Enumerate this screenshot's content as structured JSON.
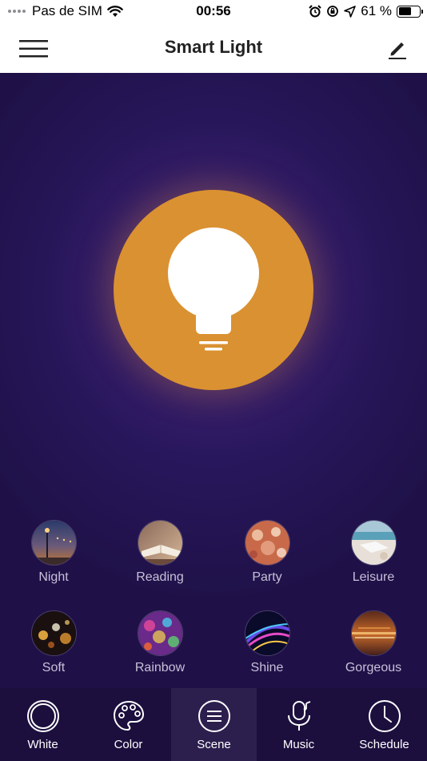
{
  "status_bar": {
    "carrier": "Pas de SIM",
    "time": "00:56",
    "battery": "61 %",
    "battery_level": 0.61
  },
  "nav": {
    "title": "Smart Light",
    "menu_icon": "hamburger-menu-icon",
    "edit_icon": "pencil-icon"
  },
  "bulb": {
    "color": "#da9131",
    "icon": "light-bulb-icon"
  },
  "scenes": [
    {
      "label": "Night"
    },
    {
      "label": "Reading"
    },
    {
      "label": "Party"
    },
    {
      "label": "Leisure"
    },
    {
      "label": "Soft"
    },
    {
      "label": "Rainbow"
    },
    {
      "label": "Shine"
    },
    {
      "label": "Gorgeous"
    }
  ],
  "tabs": [
    {
      "label": "White",
      "icon": "circle-icon"
    },
    {
      "label": "Color",
      "icon": "palette-icon"
    },
    {
      "label": "Scene",
      "icon": "scene-list-icon",
      "active": true
    },
    {
      "label": "Music",
      "icon": "microphone-icon"
    },
    {
      "label": "Schedule",
      "icon": "clock-icon"
    }
  ],
  "colors": {
    "accent": "#da9131",
    "background": "#25155a",
    "tab_bar": "#1c0f3e"
  }
}
